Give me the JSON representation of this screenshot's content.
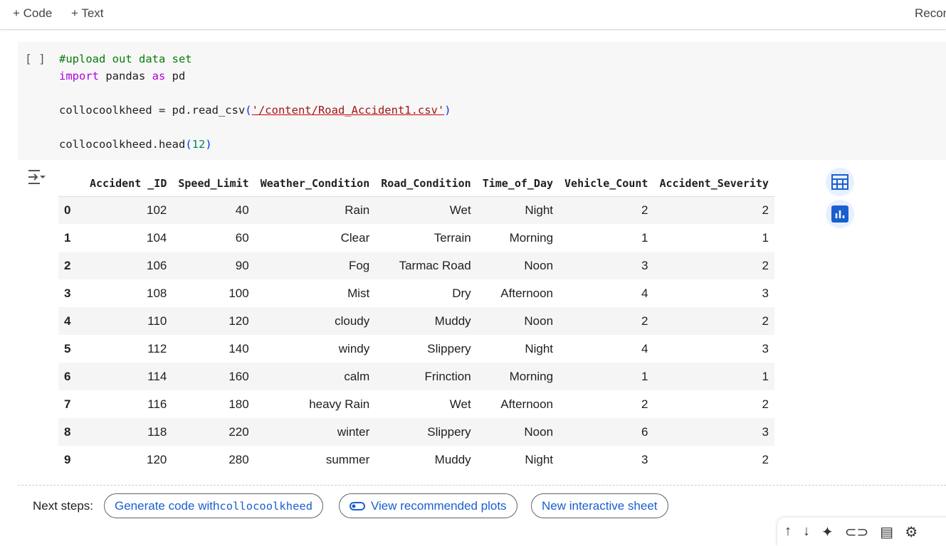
{
  "toolbar": {
    "code": "+ Code",
    "text": "+ Text",
    "right": "Recon"
  },
  "cell": {
    "run": "[ ]",
    "lines": {
      "comment": "#upload out data set",
      "import_kw": "import",
      "import_mod": " pandas ",
      "as_kw": "as",
      "alias": " pd",
      "assign": "collocoolkheed = pd.read_csv",
      "path": "'/content/Road_Accident1.csv'",
      "head": "collocoolkheed.head",
      "head_arg": "12"
    }
  },
  "table": {
    "columns": [
      "",
      "Accident _ID",
      "Speed_Limit",
      "Weather_Condition",
      "Road_Condition",
      "Time_of_Day",
      "Vehicle_Count",
      "Accident_Severity"
    ],
    "rows": [
      [
        "0",
        "102",
        "40",
        "Rain",
        "Wet",
        "Night",
        "2",
        "2"
      ],
      [
        "1",
        "104",
        "60",
        "Clear",
        "Terrain",
        "Morning",
        "1",
        "1"
      ],
      [
        "2",
        "106",
        "90",
        "Fog",
        "Tarmac Road",
        "Noon",
        "3",
        "2"
      ],
      [
        "3",
        "108",
        "100",
        "Mist",
        "Dry",
        "Afternoon",
        "4",
        "3"
      ],
      [
        "4",
        "110",
        "120",
        "cloudy",
        "Muddy",
        "Noon",
        "2",
        "2"
      ],
      [
        "5",
        "112",
        "140",
        "windy",
        "Slippery",
        "Night",
        "4",
        "3"
      ],
      [
        "6",
        "114",
        "160",
        "calm",
        "Frinction",
        "Morning",
        "1",
        "1"
      ],
      [
        "7",
        "116",
        "180",
        "heavy Rain",
        "Wet",
        "Afternoon",
        "2",
        "2"
      ],
      [
        "8",
        "118",
        "220",
        "winter",
        "Slippery",
        "Noon",
        "6",
        "3"
      ],
      [
        "9",
        "120",
        "280",
        "summer",
        "Muddy",
        "Night",
        "3",
        "2"
      ]
    ]
  },
  "next": {
    "label": "Next steps:",
    "gen": "Generate code with ",
    "gen_var": "collocoolkheed",
    "plots": "View recommended plots",
    "sheet": "New interactive sheet"
  },
  "accent": "#1a5fd0"
}
